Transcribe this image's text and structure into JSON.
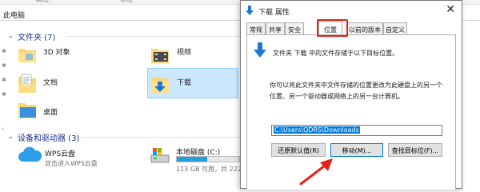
{
  "explorer": {
    "ribbon": {
      "tab1": "网络",
      "tab2": "系统"
    },
    "address": "此电脑",
    "folders_group": {
      "title": "文件夹 (7)"
    },
    "folders": [
      {
        "label": "3D 对象"
      },
      {
        "label": "视频"
      },
      {
        "label": "文档"
      },
      {
        "label": "下载"
      },
      {
        "label": "桌面"
      }
    ],
    "devices_group": {
      "title": "设备和驱动器 (3)"
    },
    "devices": [
      {
        "label": "WPS云盘",
        "sub": "双击进入WPS云盘"
      },
      {
        "label": "本地磁盘 (C:)",
        "sub": "113 GB 可用，共 222",
        "used_fraction": 0.49
      }
    ]
  },
  "dialog": {
    "title": "下载 属性",
    "close": "✕",
    "tabs": [
      "常规",
      "共享",
      "安全",
      "位置",
      "以前的版本",
      "自定义"
    ],
    "active_tab": "位置",
    "desc1": "文件夹 下载 中的文件存储于以下目标位置。",
    "desc2": "你可以将此文件夹中文件存储的位置更改为此硬盘上的另一个位置、另一个驱动器或网络上的另一台计算机。",
    "path": "C:\\Users\\QDRS\\Downloads",
    "buttons": {
      "restore": "还原默认值(R)",
      "move": "移动(M)...",
      "find": "查找目标位(F)..."
    }
  },
  "colors": {
    "accent": "#0078d7",
    "annotation": "#e2231a",
    "selection": "#cce8ff"
  }
}
